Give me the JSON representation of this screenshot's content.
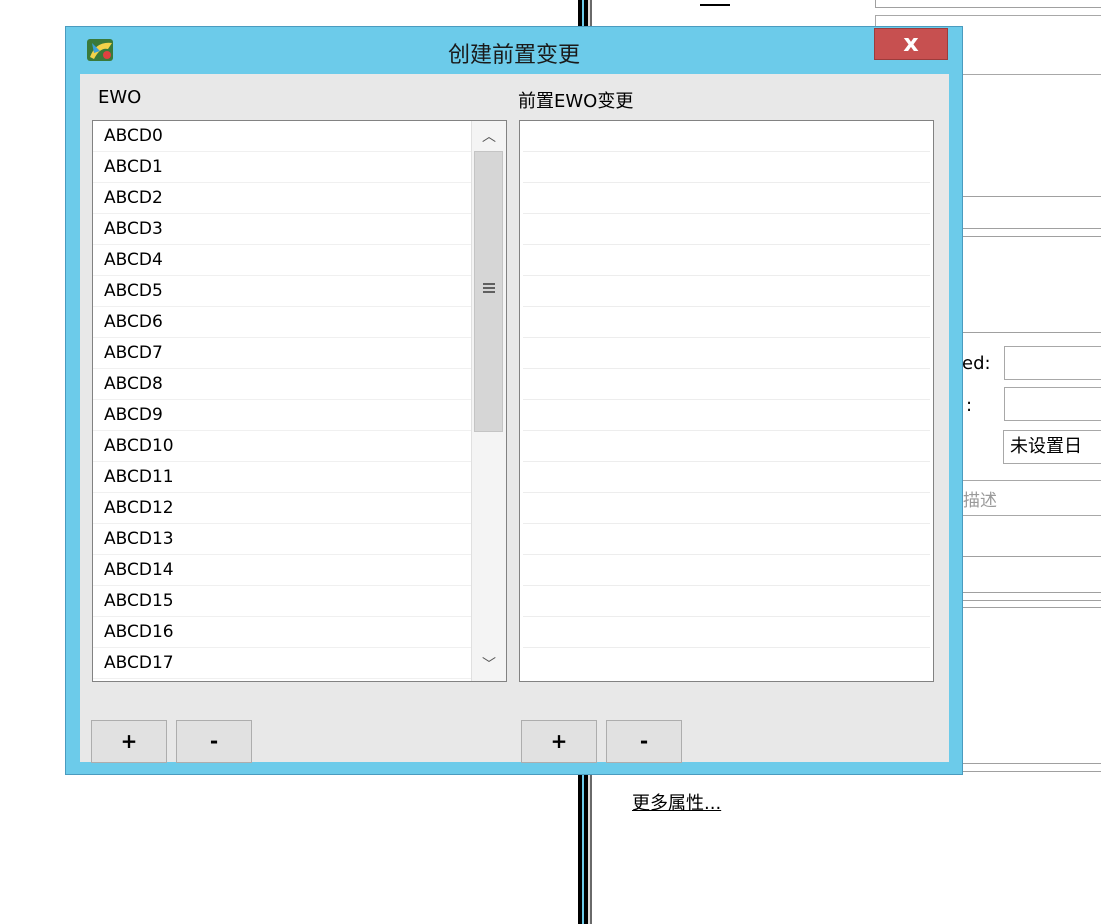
{
  "background": {
    "labels": {
      "field_label_1": "ed:",
      "field_label_2": ":",
      "unset_field": "未设置日",
      "description_placeholder": "描述",
      "more_properties_link": "更多属性..."
    }
  },
  "dialog": {
    "title": "创建前置变更",
    "close_label": "x",
    "icon": "app-logo-icon",
    "left_label": "EWO",
    "right_label": "前置EWO变更",
    "ewo_items": [
      "ABCD0",
      "ABCD1",
      "ABCD2",
      "ABCD3",
      "ABCD4",
      "ABCD5",
      "ABCD6",
      "ABCD7",
      "ABCD8",
      "ABCD9",
      "ABCD10",
      "ABCD11",
      "ABCD12",
      "ABCD13",
      "ABCD14",
      "ABCD15",
      "ABCD16",
      "ABCD17"
    ],
    "pre_ewo_items": [],
    "scroll_up_glyph": "︿",
    "scroll_down_glyph": "﹀",
    "buttons": {
      "left_add": "+",
      "left_remove": "-",
      "right_add": "+",
      "right_remove": "-"
    }
  },
  "colors": {
    "dialog_frame": "#6ccbea",
    "close_button": "#c75050",
    "client_area": "#e8e8e8"
  }
}
